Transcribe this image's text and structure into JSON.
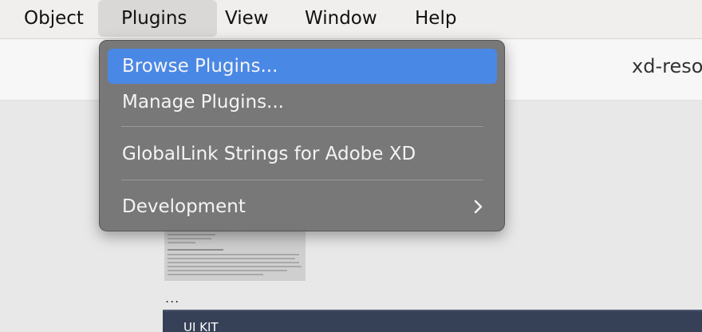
{
  "menubar": {
    "items": [
      {
        "label": "Object"
      },
      {
        "label": "Plugins"
      },
      {
        "label": "View"
      },
      {
        "label": "Window"
      },
      {
        "label": "Help"
      }
    ],
    "active_index": 1
  },
  "toolbar": {
    "doc_title": "xd-reso"
  },
  "plugins_menu": {
    "items": [
      {
        "label": "Browse Plugins..."
      },
      {
        "label": "Manage Plugins..."
      },
      {
        "label": "GlobalLink Strings for Adobe XD"
      },
      {
        "label": "Development"
      }
    ],
    "highlighted_index": 0
  },
  "canvas": {
    "more_label": "...",
    "uikit_label": "UI KIT"
  },
  "colors": {
    "menu_bg": "#747474",
    "highlight": "#4a88e6",
    "artboard_dark": "#364158"
  },
  "icons": {
    "submenu_indicator": "chevron-right-icon"
  }
}
